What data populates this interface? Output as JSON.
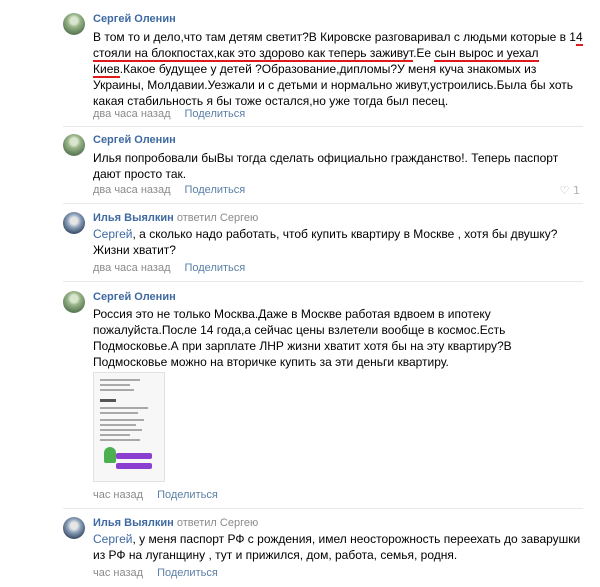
{
  "comments": [
    {
      "author": "Сергей Оленин",
      "text": "В том то и дело,что там детям светит?В Кировске разговаривал с людьми которые в 14 стояли на блокпостах,как это здорово как теперь заживут.Ее сын вырос и уехал Киев.Какое будущее у детей ?Образование,дипломы?У меня куча знакомых из Украины, Молдавии.Уезжали и с детьми и нормально живут,устроились.Была бы хоть какая стабильность я бы тоже остался,но уже тогда был песец.",
      "time": "два часа назад",
      "share": "Поделиться"
    },
    {
      "author": "Сергей Оленин",
      "text": "Илья попробовали быВы тогда сделать официально гражданство!. Теперь паспорт дают просто так.",
      "time": "два часа назад",
      "share": "Поделиться",
      "likes": "1"
    },
    {
      "author": "Илья Выялкин",
      "reply_prefix": "ответил",
      "reply_to": "Сергею",
      "mention": "Сергей",
      "text": ", а сколько надо работать, чтоб купить квартиру в Москве , хотя бы двушку? Жизни хватит?",
      "time": "два часа назад",
      "share": "Поделиться"
    },
    {
      "author": "Сергей Оленин",
      "text": "Россия это не только Москва.Даже в Москве работая вдвоем в ипотеку пожалуйста.После 14 года,а сейчас цены взлетели вообще в космос.Есть Подмосковье.А при зарплате ЛНР жизни хватит хотя бы на эту квартиру?В Подмосковье можно на вторичке купить за эти деньги квартиру.",
      "time": "час назад",
      "share": "Поделиться"
    },
    {
      "author": "Илья Выялкин",
      "reply_prefix": "ответил",
      "reply_to": "Сергею",
      "mention": "Сергей",
      "text": ", у меня паспорт РФ с рождения, имел неосторожность переехать до заварушки из РФ на луганщину , тут и прижился, дом, работа, семья, родня.",
      "time": "час назад",
      "share": "Поделиться"
    }
  ],
  "colors": {
    "link": "#3e6aa1",
    "muted": "#8b8b8b",
    "underline": "#e01a1a"
  }
}
